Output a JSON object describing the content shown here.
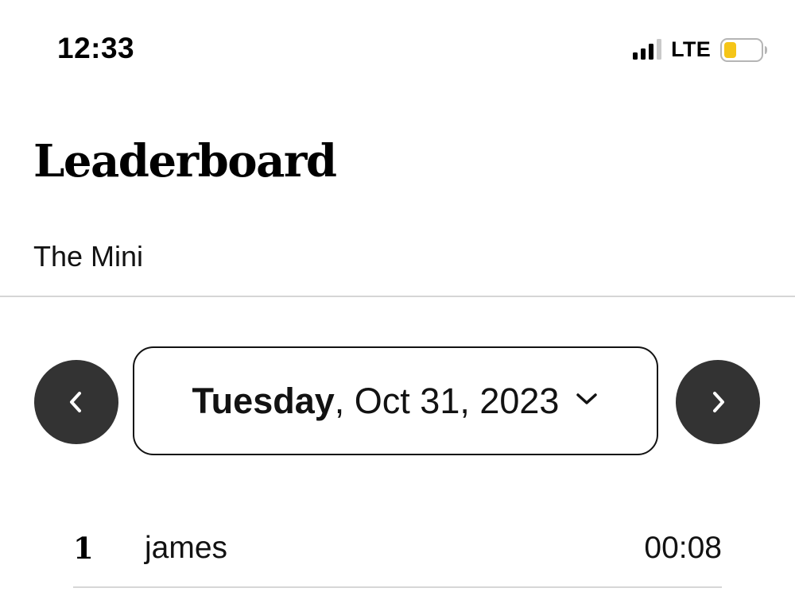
{
  "status_bar": {
    "time": "12:33",
    "network": "LTE",
    "signal_bars_active": 3,
    "signal_bars_total": 4,
    "battery_level": 0.35,
    "battery_color": "#f5c518"
  },
  "header": {
    "title": "Leaderboard",
    "game": "The Mini"
  },
  "date_nav": {
    "prev_icon": "chevron-left-icon",
    "next_icon": "chevron-right-icon",
    "day": "Tuesday",
    "separator": ",",
    "date": " Oct 31, 2023",
    "dropdown_icon": "chevron-down-icon"
  },
  "leaderboard": {
    "rows": [
      {
        "rank": "1",
        "name": "james",
        "time": "00:08"
      }
    ]
  },
  "colors": {
    "nav_button_bg": "#333333",
    "divider": "#d6d6d6",
    "text": "#121212"
  }
}
